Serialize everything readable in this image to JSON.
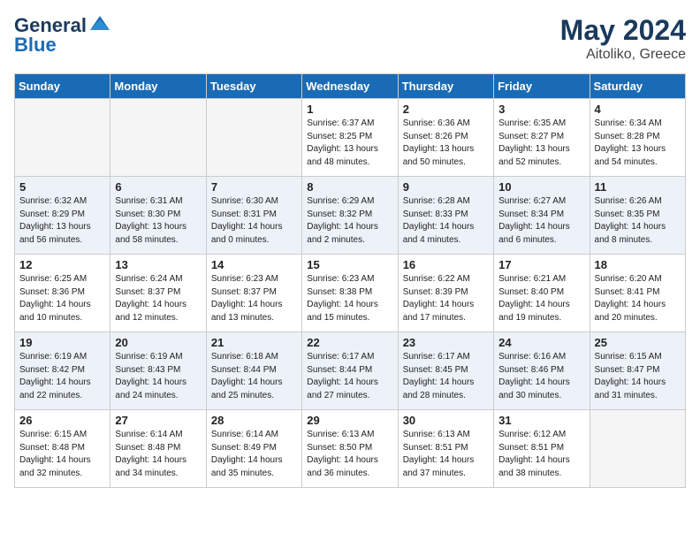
{
  "header": {
    "logo_line1": "General",
    "logo_line2": "Blue",
    "month": "May 2024",
    "location": "Aitoliko, Greece"
  },
  "days_of_week": [
    "Sunday",
    "Monday",
    "Tuesday",
    "Wednesday",
    "Thursday",
    "Friday",
    "Saturday"
  ],
  "weeks": [
    [
      {
        "day": "",
        "sunrise": "",
        "sunset": "",
        "daylight": "",
        "empty": true
      },
      {
        "day": "",
        "sunrise": "",
        "sunset": "",
        "daylight": "",
        "empty": true
      },
      {
        "day": "",
        "sunrise": "",
        "sunset": "",
        "daylight": "",
        "empty": true
      },
      {
        "day": "1",
        "sunrise": "Sunrise: 6:37 AM",
        "sunset": "Sunset: 8:25 PM",
        "daylight": "Daylight: 13 hours and 48 minutes.",
        "empty": false
      },
      {
        "day": "2",
        "sunrise": "Sunrise: 6:36 AM",
        "sunset": "Sunset: 8:26 PM",
        "daylight": "Daylight: 13 hours and 50 minutes.",
        "empty": false
      },
      {
        "day": "3",
        "sunrise": "Sunrise: 6:35 AM",
        "sunset": "Sunset: 8:27 PM",
        "daylight": "Daylight: 13 hours and 52 minutes.",
        "empty": false
      },
      {
        "day": "4",
        "sunrise": "Sunrise: 6:34 AM",
        "sunset": "Sunset: 8:28 PM",
        "daylight": "Daylight: 13 hours and 54 minutes.",
        "empty": false
      }
    ],
    [
      {
        "day": "5",
        "sunrise": "Sunrise: 6:32 AM",
        "sunset": "Sunset: 8:29 PM",
        "daylight": "Daylight: 13 hours and 56 minutes.",
        "empty": false
      },
      {
        "day": "6",
        "sunrise": "Sunrise: 6:31 AM",
        "sunset": "Sunset: 8:30 PM",
        "daylight": "Daylight: 13 hours and 58 minutes.",
        "empty": false
      },
      {
        "day": "7",
        "sunrise": "Sunrise: 6:30 AM",
        "sunset": "Sunset: 8:31 PM",
        "daylight": "Daylight: 14 hours and 0 minutes.",
        "empty": false
      },
      {
        "day": "8",
        "sunrise": "Sunrise: 6:29 AM",
        "sunset": "Sunset: 8:32 PM",
        "daylight": "Daylight: 14 hours and 2 minutes.",
        "empty": false
      },
      {
        "day": "9",
        "sunrise": "Sunrise: 6:28 AM",
        "sunset": "Sunset: 8:33 PM",
        "daylight": "Daylight: 14 hours and 4 minutes.",
        "empty": false
      },
      {
        "day": "10",
        "sunrise": "Sunrise: 6:27 AM",
        "sunset": "Sunset: 8:34 PM",
        "daylight": "Daylight: 14 hours and 6 minutes.",
        "empty": false
      },
      {
        "day": "11",
        "sunrise": "Sunrise: 6:26 AM",
        "sunset": "Sunset: 8:35 PM",
        "daylight": "Daylight: 14 hours and 8 minutes.",
        "empty": false
      }
    ],
    [
      {
        "day": "12",
        "sunrise": "Sunrise: 6:25 AM",
        "sunset": "Sunset: 8:36 PM",
        "daylight": "Daylight: 14 hours and 10 minutes.",
        "empty": false
      },
      {
        "day": "13",
        "sunrise": "Sunrise: 6:24 AM",
        "sunset": "Sunset: 8:37 PM",
        "daylight": "Daylight: 14 hours and 12 minutes.",
        "empty": false
      },
      {
        "day": "14",
        "sunrise": "Sunrise: 6:23 AM",
        "sunset": "Sunset: 8:37 PM",
        "daylight": "Daylight: 14 hours and 13 minutes.",
        "empty": false
      },
      {
        "day": "15",
        "sunrise": "Sunrise: 6:23 AM",
        "sunset": "Sunset: 8:38 PM",
        "daylight": "Daylight: 14 hours and 15 minutes.",
        "empty": false
      },
      {
        "day": "16",
        "sunrise": "Sunrise: 6:22 AM",
        "sunset": "Sunset: 8:39 PM",
        "daylight": "Daylight: 14 hours and 17 minutes.",
        "empty": false
      },
      {
        "day": "17",
        "sunrise": "Sunrise: 6:21 AM",
        "sunset": "Sunset: 8:40 PM",
        "daylight": "Daylight: 14 hours and 19 minutes.",
        "empty": false
      },
      {
        "day": "18",
        "sunrise": "Sunrise: 6:20 AM",
        "sunset": "Sunset: 8:41 PM",
        "daylight": "Daylight: 14 hours and 20 minutes.",
        "empty": false
      }
    ],
    [
      {
        "day": "19",
        "sunrise": "Sunrise: 6:19 AM",
        "sunset": "Sunset: 8:42 PM",
        "daylight": "Daylight: 14 hours and 22 minutes.",
        "empty": false
      },
      {
        "day": "20",
        "sunrise": "Sunrise: 6:19 AM",
        "sunset": "Sunset: 8:43 PM",
        "daylight": "Daylight: 14 hours and 24 minutes.",
        "empty": false
      },
      {
        "day": "21",
        "sunrise": "Sunrise: 6:18 AM",
        "sunset": "Sunset: 8:44 PM",
        "daylight": "Daylight: 14 hours and 25 minutes.",
        "empty": false
      },
      {
        "day": "22",
        "sunrise": "Sunrise: 6:17 AM",
        "sunset": "Sunset: 8:44 PM",
        "daylight": "Daylight: 14 hours and 27 minutes.",
        "empty": false
      },
      {
        "day": "23",
        "sunrise": "Sunrise: 6:17 AM",
        "sunset": "Sunset: 8:45 PM",
        "daylight": "Daylight: 14 hours and 28 minutes.",
        "empty": false
      },
      {
        "day": "24",
        "sunrise": "Sunrise: 6:16 AM",
        "sunset": "Sunset: 8:46 PM",
        "daylight": "Daylight: 14 hours and 30 minutes.",
        "empty": false
      },
      {
        "day": "25",
        "sunrise": "Sunrise: 6:15 AM",
        "sunset": "Sunset: 8:47 PM",
        "daylight": "Daylight: 14 hours and 31 minutes.",
        "empty": false
      }
    ],
    [
      {
        "day": "26",
        "sunrise": "Sunrise: 6:15 AM",
        "sunset": "Sunset: 8:48 PM",
        "daylight": "Daylight: 14 hours and 32 minutes.",
        "empty": false
      },
      {
        "day": "27",
        "sunrise": "Sunrise: 6:14 AM",
        "sunset": "Sunset: 8:48 PM",
        "daylight": "Daylight: 14 hours and 34 minutes.",
        "empty": false
      },
      {
        "day": "28",
        "sunrise": "Sunrise: 6:14 AM",
        "sunset": "Sunset: 8:49 PM",
        "daylight": "Daylight: 14 hours and 35 minutes.",
        "empty": false
      },
      {
        "day": "29",
        "sunrise": "Sunrise: 6:13 AM",
        "sunset": "Sunset: 8:50 PM",
        "daylight": "Daylight: 14 hours and 36 minutes.",
        "empty": false
      },
      {
        "day": "30",
        "sunrise": "Sunrise: 6:13 AM",
        "sunset": "Sunset: 8:51 PM",
        "daylight": "Daylight: 14 hours and 37 minutes.",
        "empty": false
      },
      {
        "day": "31",
        "sunrise": "Sunrise: 6:12 AM",
        "sunset": "Sunset: 8:51 PM",
        "daylight": "Daylight: 14 hours and 38 minutes.",
        "empty": false
      },
      {
        "day": "",
        "sunrise": "",
        "sunset": "",
        "daylight": "",
        "empty": true
      }
    ]
  ]
}
